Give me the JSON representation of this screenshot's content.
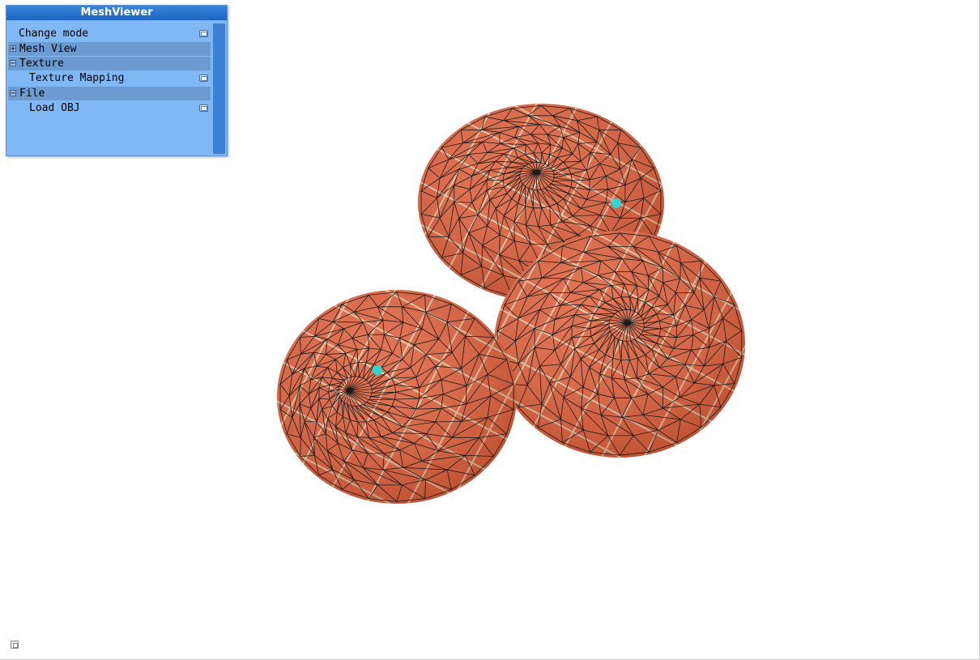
{
  "window": {
    "title": "MeshViewer"
  },
  "panel": {
    "items": [
      {
        "label": "Change mode",
        "kind": "button"
      },
      {
        "label": "Mesh View",
        "kind": "group",
        "state": "+"
      },
      {
        "label": "Texture",
        "kind": "group",
        "state": "−"
      },
      {
        "label": "Texture Mapping",
        "kind": "button"
      },
      {
        "label": "File",
        "kind": "group",
        "state": "−"
      },
      {
        "label": "Load OBJ",
        "kind": "button"
      }
    ]
  },
  "viewport": {
    "mesh_color": "#e0633e",
    "edge_color": "#1a1a1a",
    "texture_line_color": "#e8c8a6",
    "marker_color": "#2fd6d2",
    "markers": 2
  }
}
